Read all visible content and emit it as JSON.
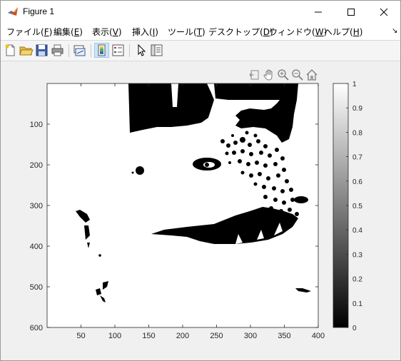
{
  "window": {
    "title": "Figure 1"
  },
  "menu": {
    "items": [
      {
        "label": "ファイル(",
        "key": "F",
        "suffix": ")"
      },
      {
        "label": "編集(",
        "key": "E",
        "suffix": ")"
      },
      {
        "label": "表示(",
        "key": "V",
        "suffix": ")"
      },
      {
        "label": "挿入(",
        "key": "I",
        "suffix": ")"
      },
      {
        "label": "ツール(",
        "key": "T",
        "suffix": ")"
      },
      {
        "label": "デスクトップ(",
        "key": "D",
        "suffix": ")"
      },
      {
        "label": "ウィンドウ(",
        "key": "W",
        "suffix": ")"
      },
      {
        "label": "ヘルプ(",
        "key": "H",
        "suffix": ")"
      }
    ]
  },
  "toolbar": {
    "buttons": [
      "new-figure-icon",
      "open-file-icon",
      "save-icon",
      "print-icon",
      "link-plot-icon",
      "colorbar-toggle-icon",
      "legend-toggle-icon",
      "pointer-icon",
      "property-inspector-icon"
    ],
    "active": "colorbar-toggle-icon"
  },
  "axes_toolbar": {
    "buttons": [
      "brush-export-icon",
      "pan-hand-icon",
      "zoom-in-icon",
      "zoom-out-icon",
      "home-icon"
    ]
  },
  "image_plot": {
    "description_colormap": "gray",
    "x_ticks": [
      "50",
      "100",
      "150",
      "200",
      "250",
      "300",
      "350",
      "400"
    ],
    "y_ticks": [
      "100",
      "200",
      "300",
      "400",
      "500",
      "600"
    ],
    "x_range": [
      0,
      400
    ],
    "y_range": [
      0,
      600
    ]
  },
  "colorbar": {
    "ticks": [
      "0",
      "0.1",
      "0.2",
      "0.3",
      "0.4",
      "0.5",
      "0.6",
      "0.7",
      "0.8",
      "0.9",
      "1"
    ],
    "range": [
      0,
      1
    ],
    "colors": {
      "low": "#000000",
      "high": "#ffffff"
    }
  }
}
